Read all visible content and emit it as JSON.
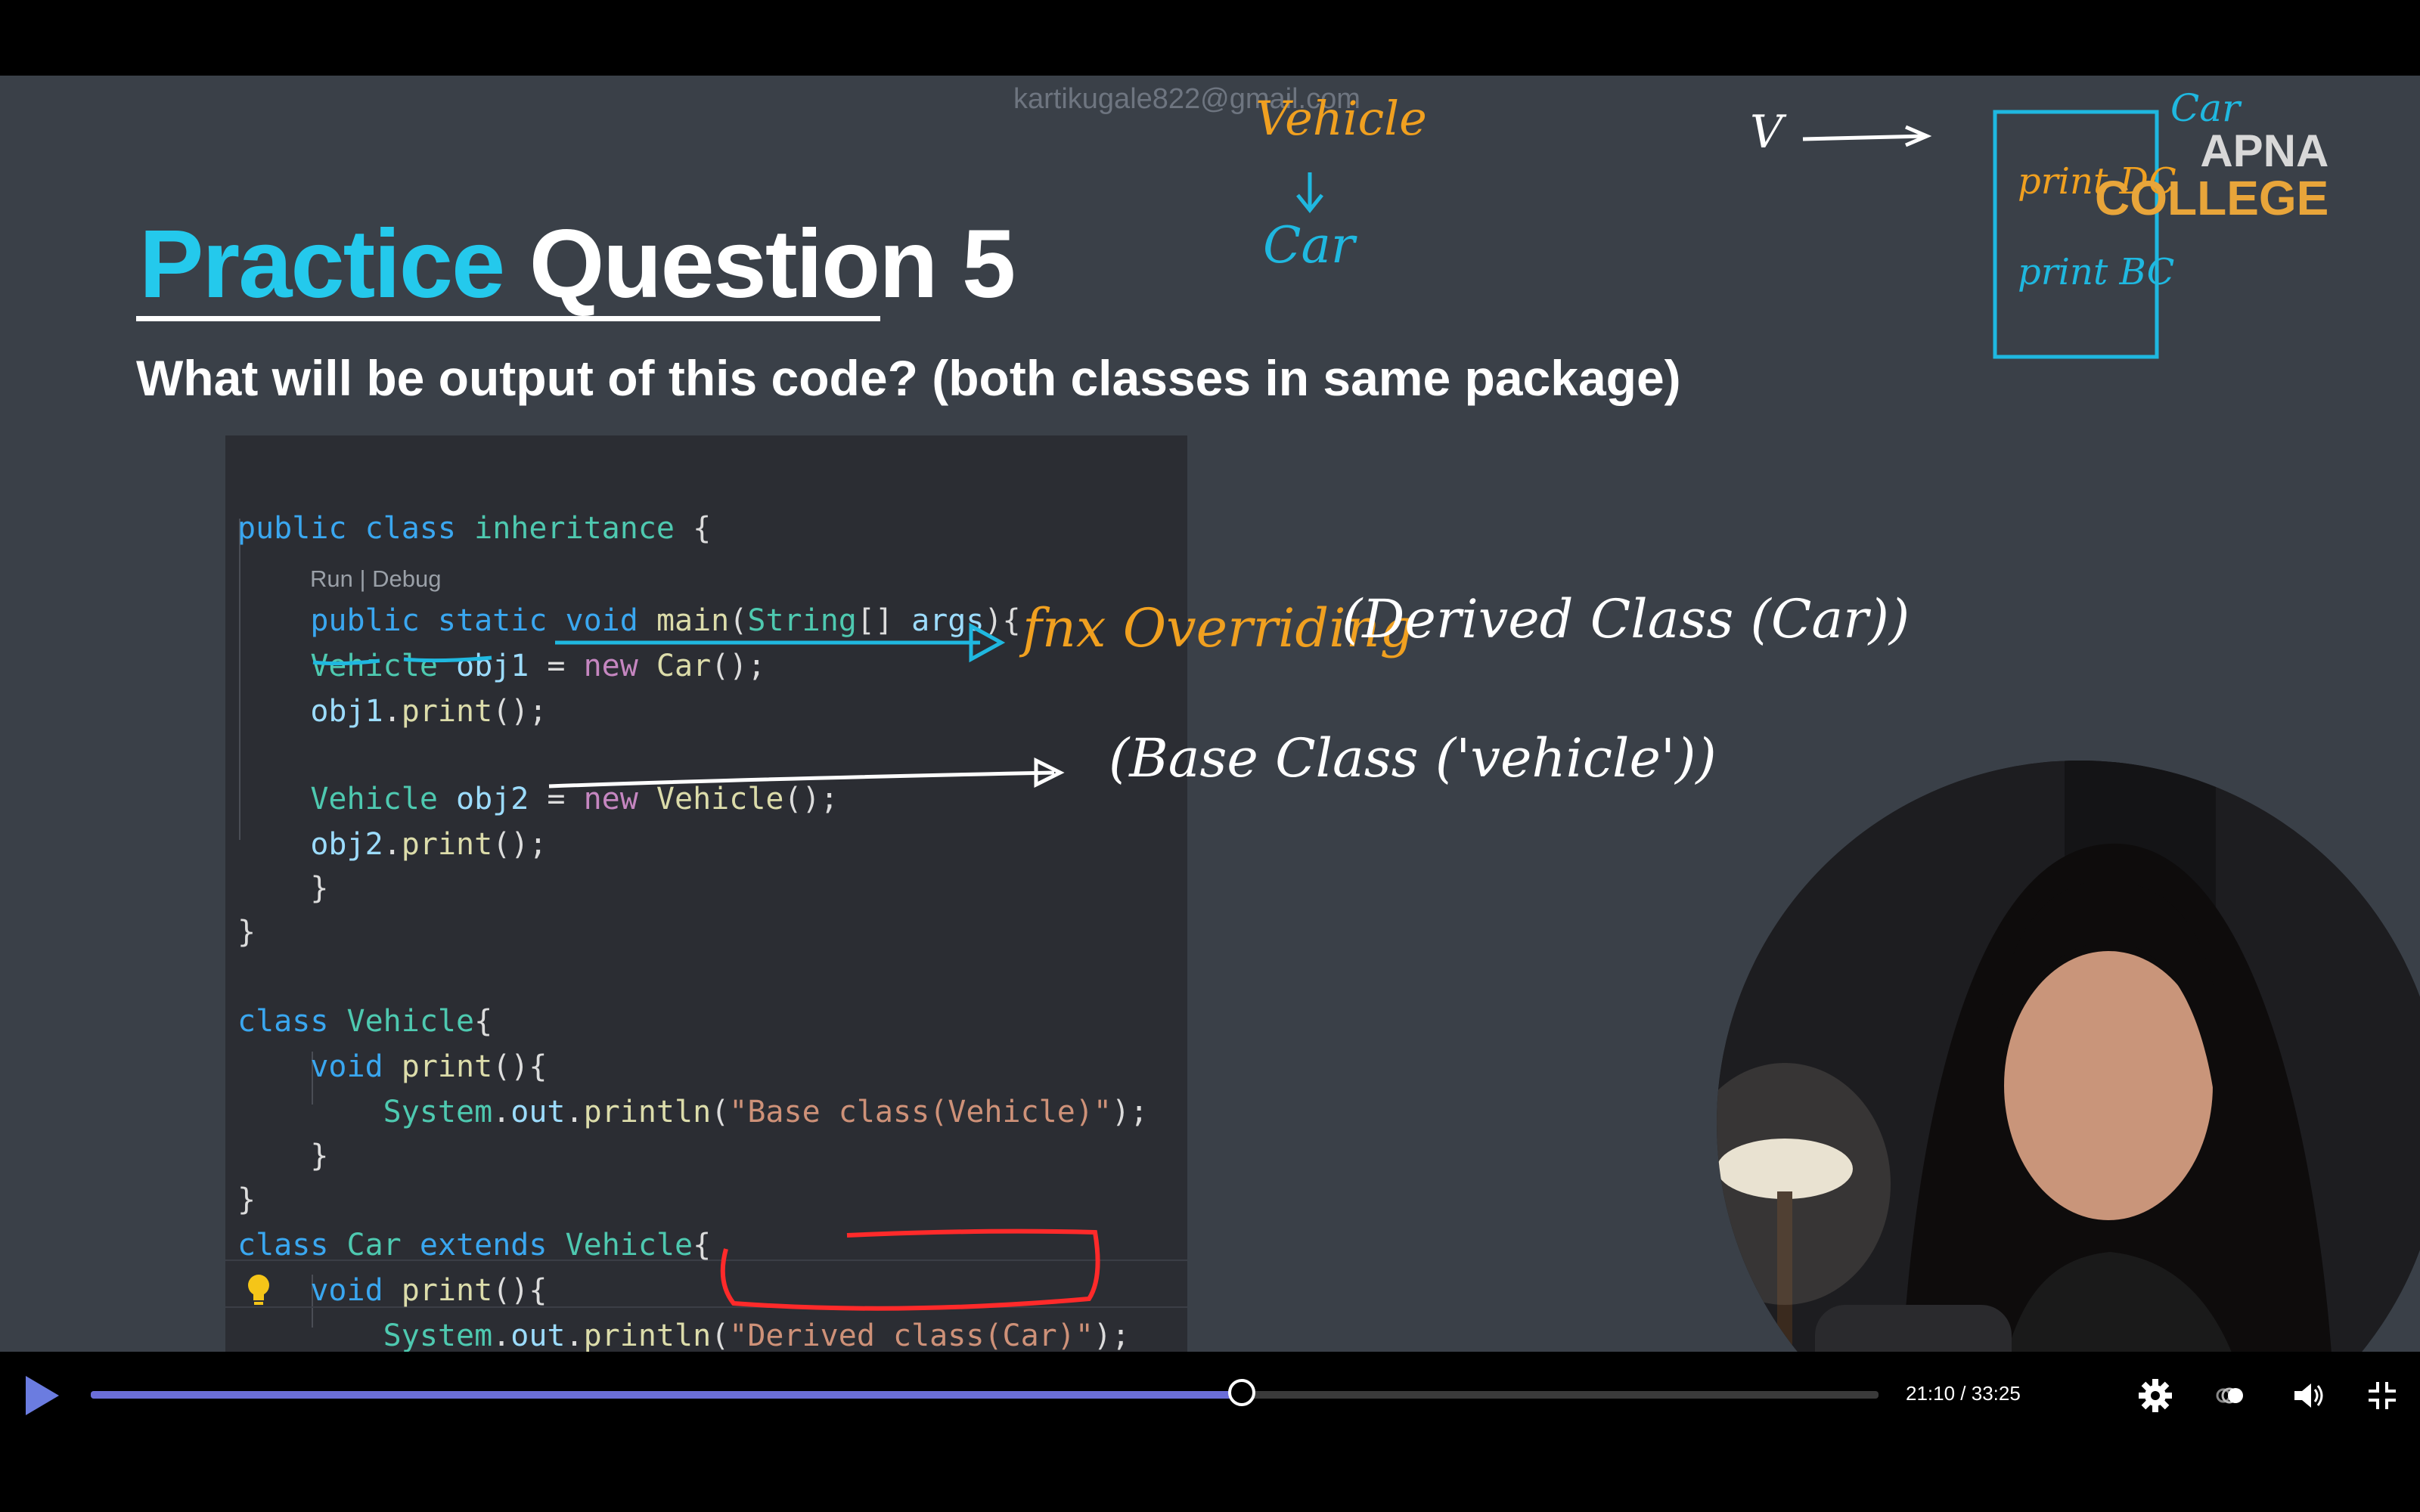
{
  "watermark": "kartikugale822@gmail.com",
  "slide": {
    "title_accent": "Practice",
    "title_rest": "Question 5",
    "subtitle": "What will be output of this code? (both classes in same package)"
  },
  "code": {
    "codelens": "Run | Debug"
  },
  "annotations": {
    "vehicle": "Vehicle",
    "car": "Car",
    "v_arrow_label": "V",
    "box_title": "Car",
    "box_print_1": "print DC",
    "box_print_2": "print BC",
    "fn_overriding": "fnx Overriding",
    "derived_note": "(Derived Class (Car))",
    "base_note": "(Base Class ('vehicle'))"
  },
  "logo": {
    "line1": "APNA",
    "line2": "COLLEGE"
  },
  "player": {
    "time_display": "21:10 / 33:25",
    "progress": 0.6438,
    "accent": "#6b6ed8"
  },
  "icons": {
    "play": "play-icon",
    "settings": "gear-icon",
    "ambient": "ambient-mode-icon",
    "volume": "volume-icon",
    "fullscreen": "exit-fullscreen-icon"
  }
}
